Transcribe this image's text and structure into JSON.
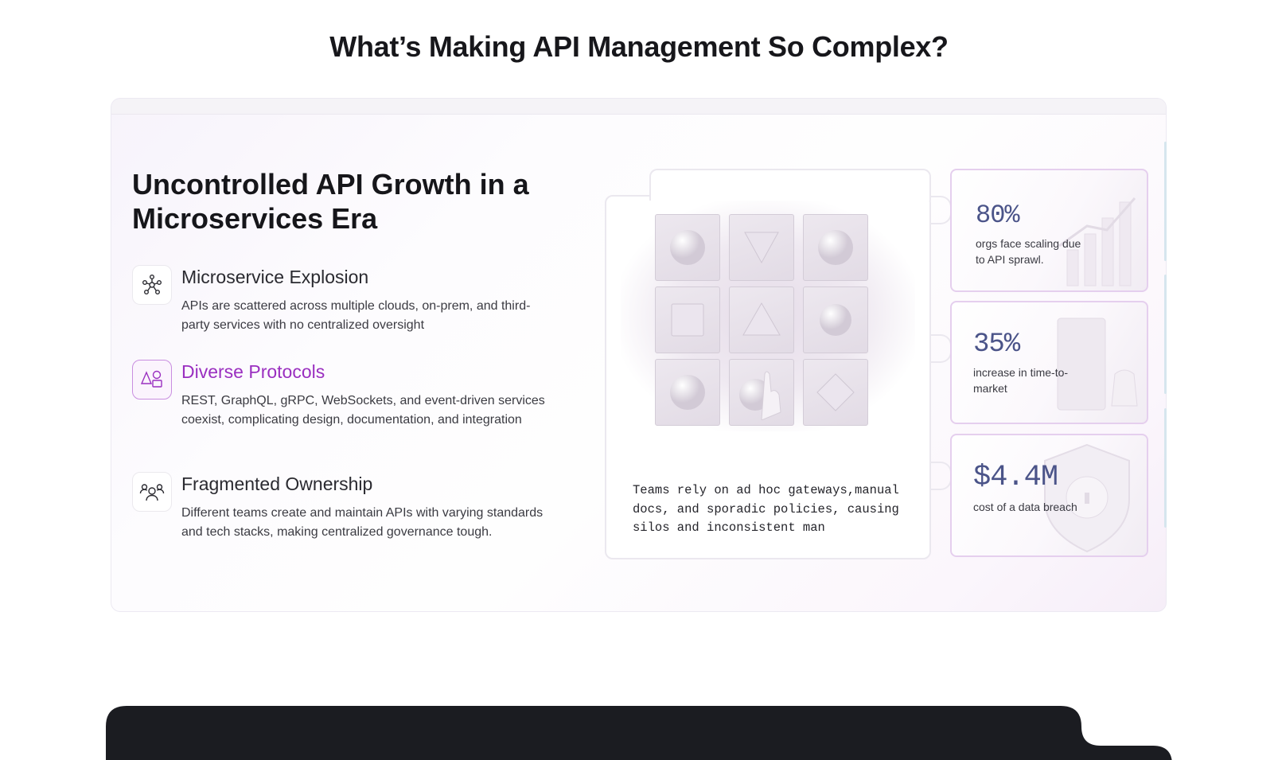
{
  "page_title": "What’s Making API Management So Complex?",
  "section": {
    "heading": "Uncontrolled API Growth in a Microservices Era",
    "features": [
      {
        "title": "Microservice Explosion",
        "description": "APIs are scattered across multiple clouds, on-prem, and third-party services with no centralized oversight",
        "icon": "network-nodes-icon",
        "active": false
      },
      {
        "title": "Diverse Protocols",
        "description": "REST, GraphQL, gRPC, WebSockets, and event-driven services coexist, complicating design, documentation, and integration",
        "icon": "shapes-icon",
        "active": true
      },
      {
        "title": "Fragmented Ownership",
        "description": "Different teams create and maintain APIs with varying standards and tech stacks, making centralized governance tough.",
        "icon": "team-icon",
        "active": false
      }
    ],
    "visual_caption": "Teams rely on ad hoc gateways,manual docs, and sporadic policies, causing silos and inconsistent man",
    "stats": [
      {
        "value": "80%",
        "label": "orgs face scaling due to API sprawl."
      },
      {
        "value": "35%",
        "label": "increase in time-to-market"
      },
      {
        "value": "$4.4M",
        "label": "cost of a data breach"
      }
    ]
  },
  "colors": {
    "accent_purple": "#9a2fc0",
    "stat_value": "#4b5489",
    "dark_banner": "#1b1c21"
  }
}
